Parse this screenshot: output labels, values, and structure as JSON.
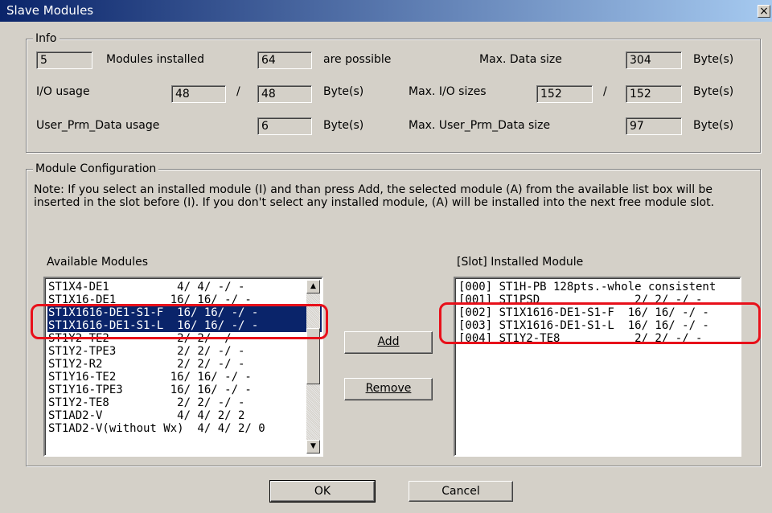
{
  "window": {
    "title": "Slave Modules",
    "close_glyph": "×"
  },
  "info": {
    "legend": "Info",
    "modules_installed": {
      "value": "5",
      "label": "Modules installed"
    },
    "possible": {
      "value": "64",
      "label": "are possible"
    },
    "max_data_size": {
      "label": "Max. Data size",
      "value": "304",
      "unit": "Byte(s)"
    },
    "io_usage": {
      "label": "I/O usage",
      "value1": "48",
      "sep": "/",
      "value2": "48",
      "unit": "Byte(s)"
    },
    "max_io_sizes": {
      "label": "Max. I/O sizes",
      "value1": "152",
      "sep": "/",
      "value2": "152",
      "unit": "Byte(s)"
    },
    "user_prm_usage": {
      "label": "User_Prm_Data usage",
      "value": "6",
      "unit": "Byte(s)"
    },
    "max_user_prm": {
      "label": "Max. User_Prm_Data size",
      "value": "97",
      "unit": "Byte(s)"
    }
  },
  "config": {
    "legend": "Module Configuration",
    "note": "Note:   If you select an installed module (I) and than press Add, the selected module (A) from the available list box will be inserted in the slot before (I). If you don't select any installed module, (A) will be installed into the next free module slot.",
    "available_label": "Available Modules",
    "installed_label": "[Slot] Installed Module",
    "available": [
      "ST1X4-DE1          4/ 4/ -/ -",
      "ST1X16-DE1        16/ 16/ -/ -",
      "ST1X1616-DE1-S1-F  16/ 16/ -/ -",
      "ST1X1616-DE1-S1-L  16/ 16/ -/ -",
      "ST1Y2-TE2          2/ 2/ -/ -",
      "ST1Y2-TPE3         2/ 2/ -/ -",
      "ST1Y2-R2           2/ 2/ -/ -",
      "ST1Y16-TE2        16/ 16/ -/ -",
      "ST1Y16-TPE3       16/ 16/ -/ -",
      "ST1Y2-TE8          2/ 2/ -/ -",
      "ST1AD2-V           4/ 4/ 2/ 2",
      "ST1AD2-V(without Wx)  4/ 4/ 2/ 0"
    ],
    "installed": [
      "[000] ST1H-PB 128pts.-whole consistent",
      "[001] ST1PSD              2/ 2/ -/ -",
      "[002] ST1X1616-DE1-S1-F  16/ 16/ -/ -",
      "[003] ST1X1616-DE1-S1-L  16/ 16/ -/ -",
      "[004] ST1Y2-TE8           2/ 2/ -/ -"
    ],
    "add_label": "Add",
    "remove_label": "Remove"
  },
  "buttons": {
    "ok": "OK",
    "cancel": "Cancel"
  },
  "colors": {
    "selection": "#0a246a",
    "highlight": "#e8101a",
    "face": "#d4d0c8"
  }
}
